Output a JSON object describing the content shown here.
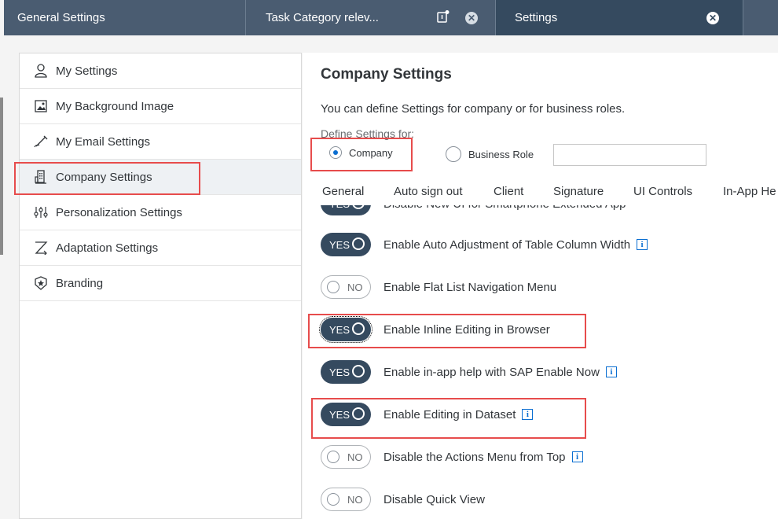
{
  "tabs": [
    {
      "label": "General Settings"
    },
    {
      "label": "Task Category relev..."
    },
    {
      "label": "Settings"
    }
  ],
  "sidebar": {
    "items": [
      {
        "label": "My Settings",
        "icon": "person-icon"
      },
      {
        "label": "My Background Image",
        "icon": "image-icon"
      },
      {
        "label": "My Email Settings",
        "icon": "pen-icon"
      },
      {
        "label": "Company Settings",
        "icon": "building-icon"
      },
      {
        "label": "Personalization Settings",
        "icon": "sliders-icon"
      },
      {
        "label": "Adaptation Settings",
        "icon": "adaptation-icon"
      },
      {
        "label": "Branding",
        "icon": "badge-icon"
      }
    ]
  },
  "main": {
    "title": "Company Settings",
    "description": "You can define Settings for company or for business roles.",
    "define_label": "Define Settings for:",
    "radios": {
      "company": "Company",
      "business_role": "Business Role",
      "selected": "Company"
    },
    "business_role_value": "",
    "tabs": [
      "General",
      "Auto sign out",
      "Client",
      "Signature",
      "UI Controls",
      "In-App He"
    ],
    "active_tab": "General",
    "settings": [
      {
        "state": "YES",
        "label": "Disable New UI for Smartphone Extended App",
        "info": false
      },
      {
        "state": "YES",
        "label": "Enable Auto Adjustment of Table Column Width",
        "info": true
      },
      {
        "state": "NO",
        "label": "Enable Flat List Navigation Menu",
        "info": false
      },
      {
        "state": "YES",
        "label": "Enable Inline Editing in Browser",
        "info": false
      },
      {
        "state": "YES",
        "label": "Enable in-app help with SAP Enable Now",
        "info": true
      },
      {
        "state": "YES",
        "label": "Enable Editing in Dataset",
        "info": true
      },
      {
        "state": "NO",
        "label": "Disable the Actions Menu from Top",
        "info": true
      },
      {
        "state": "NO",
        "label": "Disable Quick View",
        "info": false
      }
    ]
  },
  "colors": {
    "shell": "#4a5c71",
    "active_tab": "#354a5f",
    "toggle_on": "#354a5f",
    "accent": "#0a6ed1",
    "highlight": "#e74c4c"
  }
}
